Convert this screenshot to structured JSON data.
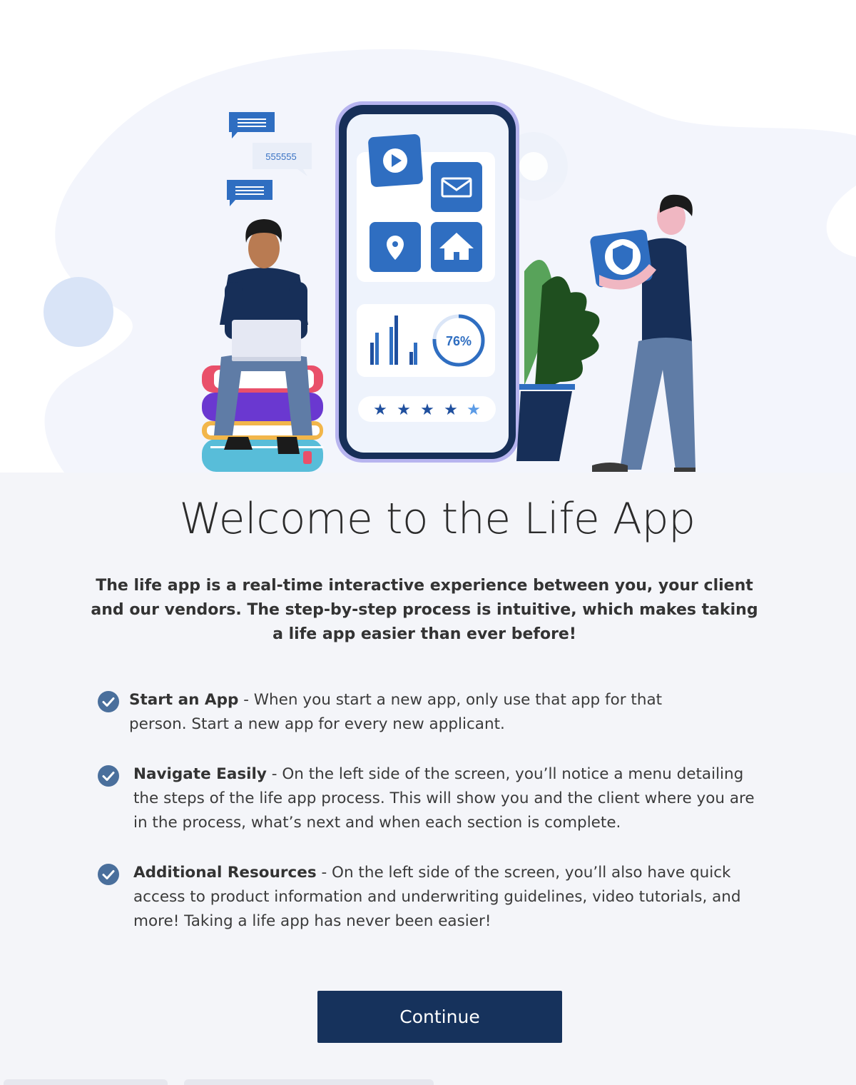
{
  "hero": {
    "chat_bubble_text": "555555",
    "stat_value": "76%",
    "rating_stars": 5
  },
  "title": "Welcome to the Life App",
  "intro": "The life app is a real-time interactive experience between you, your client and our vendors. The step-by-step process is intuitive, which makes taking a life app easier than ever before!",
  "features": [
    {
      "title": "Start an App",
      "description": " - When you start a new app, only use that app for that person. Start a new app for every new applicant."
    },
    {
      "title": "Navigate Easily",
      "description": " - On the left side of the screen, you’ll notice a menu detailing the steps of the life app process. This will show you and the client where you are in the process, what’s next and when each section is complete."
    },
    {
      "title": "Additional Resources",
      "description": " - On the left side of the screen, you’ll also have quick access to product information and underwriting guidelines, video tutorials, and more! Taking a life app has never been easier!"
    }
  ],
  "continue_label": "Continue",
  "colors": {
    "primary": "#16325c",
    "accent": "#2f6ec1",
    "check": "#4a6f9c"
  }
}
